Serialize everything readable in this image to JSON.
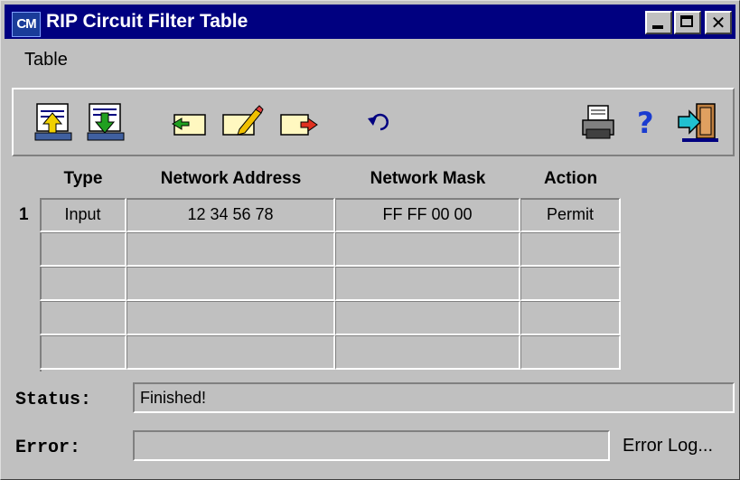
{
  "window": {
    "title": "RIP Circuit Filter Table",
    "icon_label": "CM"
  },
  "menu": {
    "items": [
      "Table"
    ]
  },
  "toolbar": {
    "icons": [
      "upload-icon",
      "download-icon",
      "add-entry-icon",
      "edit-entry-icon",
      "delete-entry-icon",
      "undo-icon",
      "print-icon",
      "help-icon",
      "exit-icon"
    ]
  },
  "table": {
    "columns": [
      "Type",
      "Network Address",
      "Network Mask",
      "Action"
    ],
    "rows": [
      {
        "num": "1",
        "type": "Input",
        "address": "12 34 56 78",
        "mask": "FF FF 00 00",
        "action": "Permit"
      },
      {
        "num": "",
        "type": "",
        "address": "",
        "mask": "",
        "action": ""
      },
      {
        "num": "",
        "type": "",
        "address": "",
        "mask": "",
        "action": ""
      },
      {
        "num": "",
        "type": "",
        "address": "",
        "mask": "",
        "action": ""
      },
      {
        "num": "",
        "type": "",
        "address": "",
        "mask": "",
        "action": ""
      }
    ]
  },
  "status": {
    "label": "Status:",
    "value": "Finished!"
  },
  "error": {
    "label": "Error:",
    "value": "",
    "log_link": "Error Log..."
  },
  "colors": {
    "titlebar": "#000080",
    "face": "#c0c0c0"
  }
}
